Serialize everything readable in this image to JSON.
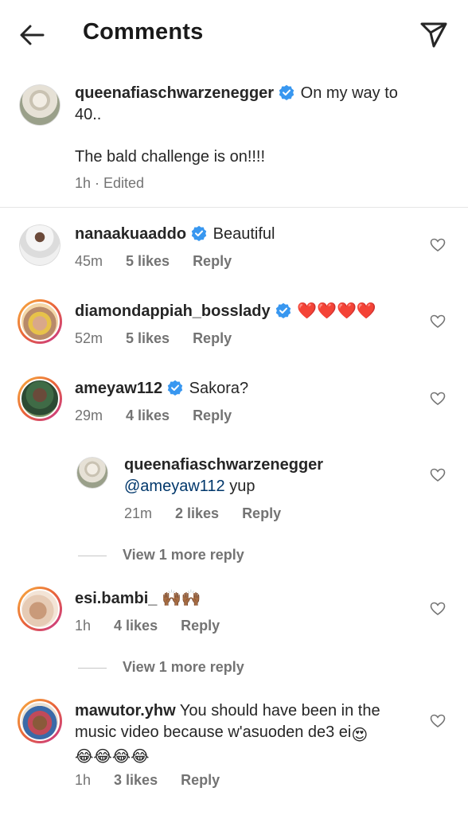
{
  "header": {
    "title": "Comments"
  },
  "caption": {
    "username": "queenafiaschwarzenegger",
    "text_line1": "On my way to",
    "text_line2": "40..",
    "text_line3": "The bald challenge is on!!!!",
    "time": "1h",
    "edited": "· Edited"
  },
  "comments": [
    {
      "username": "nanaakuaaddo",
      "text": "Beautiful",
      "time": "45m",
      "likes": "5 likes",
      "reply": "Reply"
    },
    {
      "username": "diamondappiah_bosslady",
      "text": "❤️❤️❤️❤️",
      "time": "52m",
      "likes": "5 likes",
      "reply": "Reply"
    },
    {
      "username": "ameyaw112",
      "text": "Sakora?",
      "time": "29m",
      "likes": "4 likes",
      "reply": "Reply"
    },
    {
      "username": "queenafiaschwarzenegger",
      "mention": "@ameyaw112",
      "text": "yup",
      "time": "21m",
      "likes": "2 likes",
      "reply": "Reply"
    },
    {
      "username": "esi.bambi_",
      "text": "🙌🏾🙌🏾",
      "time": "1h",
      "likes": "4 likes",
      "reply": "Reply"
    },
    {
      "username": "mawutor.yhw",
      "text_line1": "You should have been in the",
      "text_line2": "music video because w'asuoden de3 ei",
      "text_line3": "😂😂😂😂",
      "time": "1h",
      "likes": "3 likes",
      "reply": "Reply"
    }
  ],
  "view_more_1": "View 1 more reply",
  "view_more_2": "View 1 more reply",
  "icons": {
    "back": "arrow-left-icon",
    "send": "paper-plane-icon",
    "verified": "verified-badge-icon",
    "like": "heart-outline-icon"
  },
  "colors": {
    "verified": "#3897f0",
    "heart": "#ed4956",
    "muted": "#737373"
  }
}
